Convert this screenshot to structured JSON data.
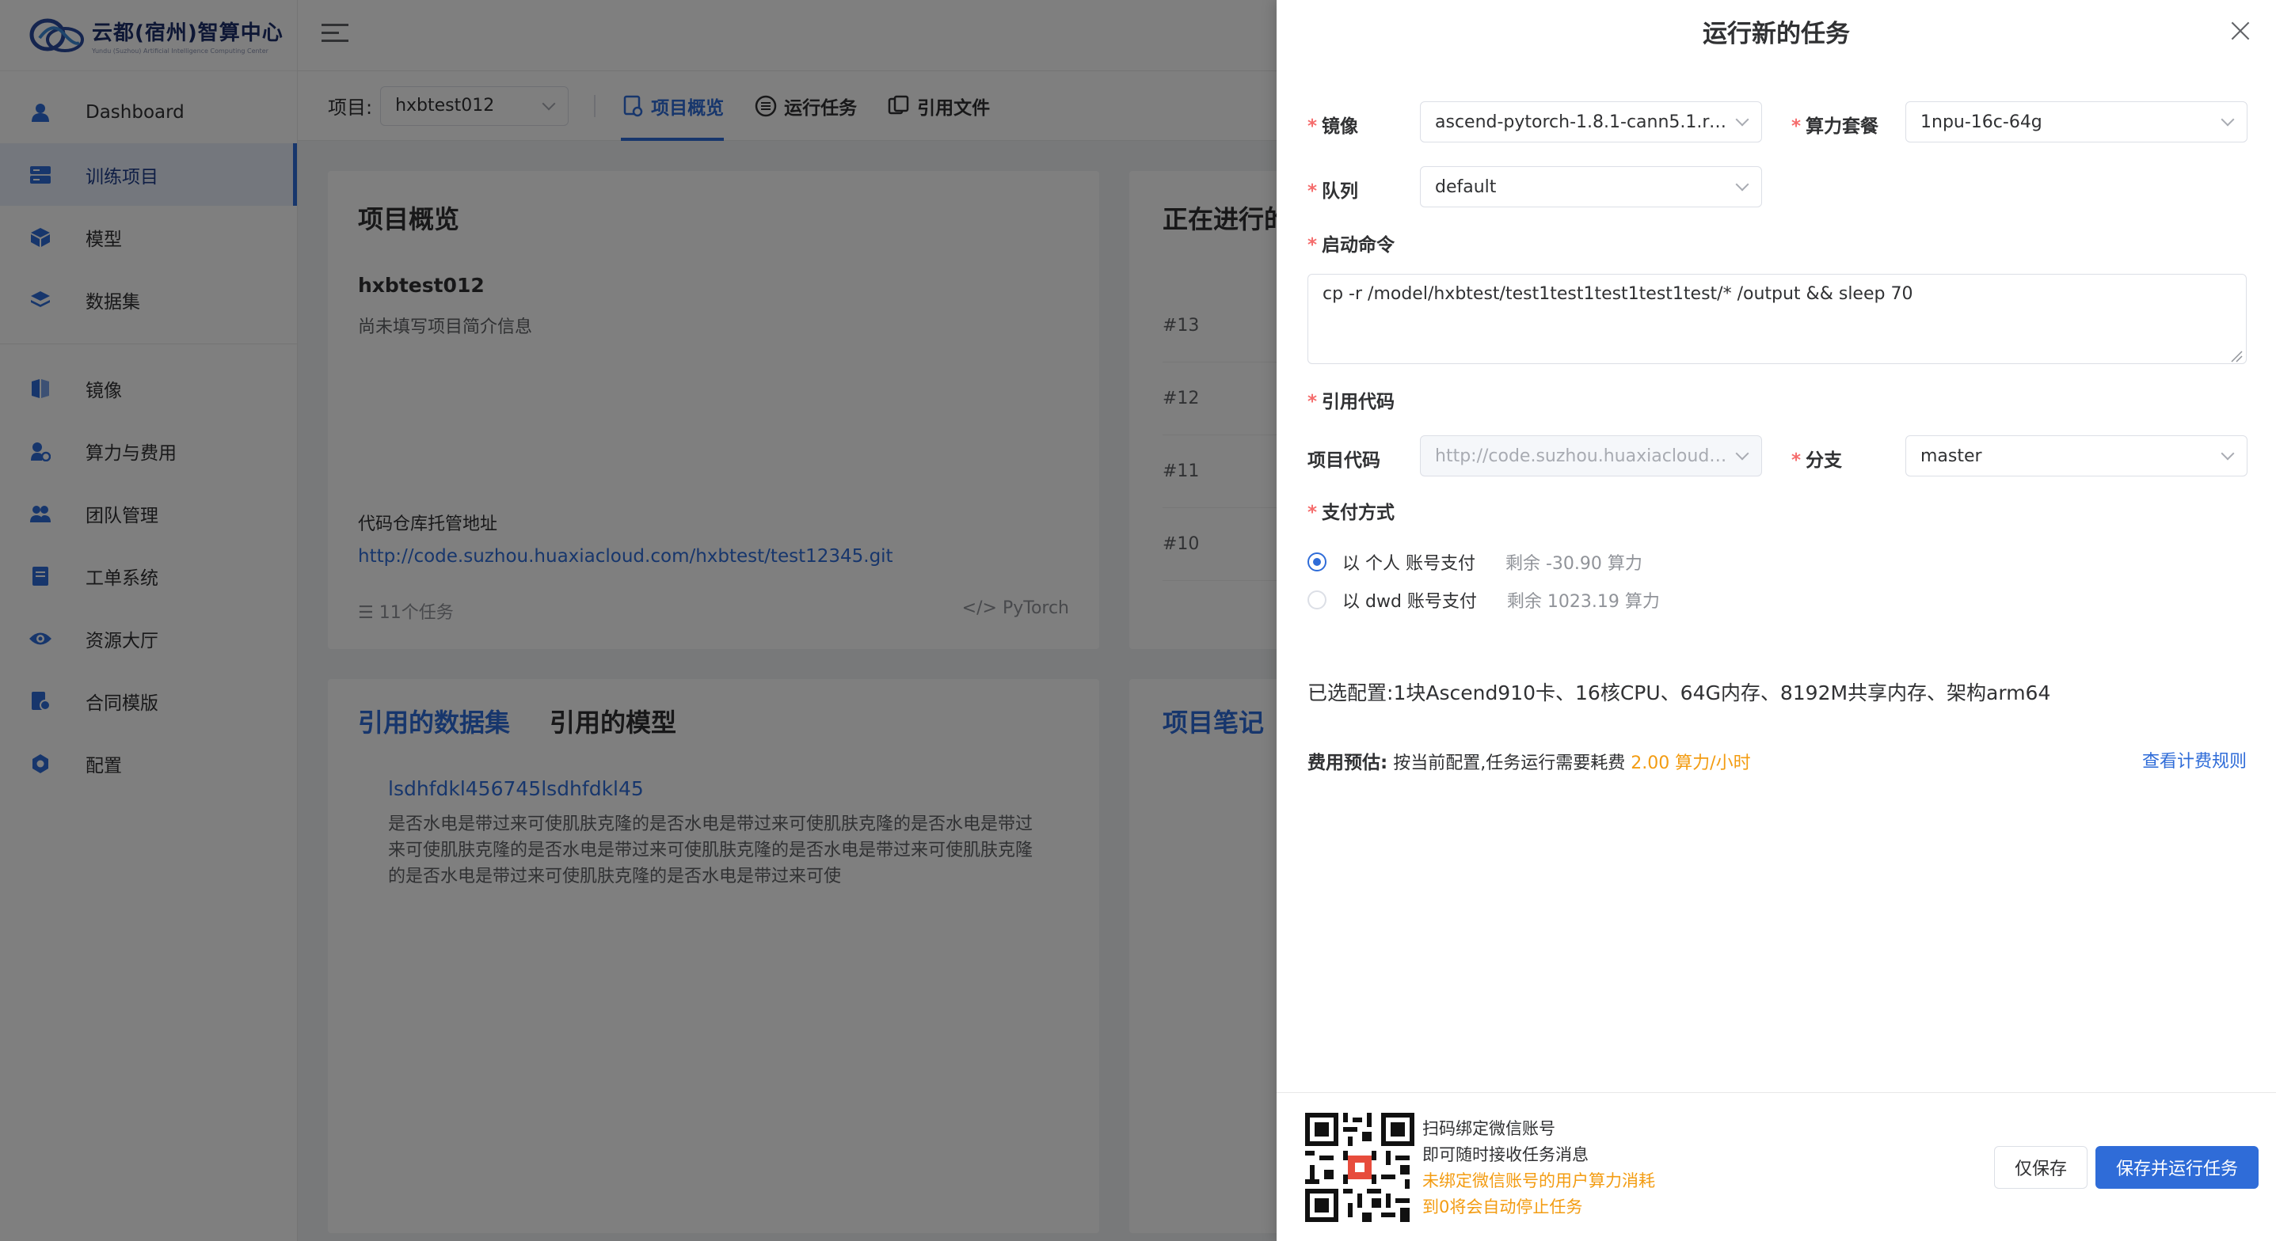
{
  "brand": {
    "title": "云都(宿州)智算中心",
    "subtitle": "Yundu (Suzhou) Artificial Intelligence Computing Center"
  },
  "sidebar": {
    "items": [
      {
        "label": "Dashboard",
        "icon": "user-icon"
      },
      {
        "label": "训练项目",
        "icon": "project-icon",
        "active": true
      },
      {
        "label": "模型",
        "icon": "cube-icon"
      },
      {
        "label": "数据集",
        "icon": "layers-icon"
      },
      {
        "label": "镜像",
        "icon": "image-icon"
      },
      {
        "label": "算力与费用",
        "icon": "compute-icon"
      },
      {
        "label": "团队管理",
        "icon": "team-icon"
      },
      {
        "label": "工单系统",
        "icon": "ticket-icon"
      },
      {
        "label": "资源大厅",
        "icon": "eye-icon"
      },
      {
        "label": "合同模版",
        "icon": "contract-icon"
      },
      {
        "label": "配置",
        "icon": "gear-icon"
      }
    ]
  },
  "subbar": {
    "project_label": "项目:",
    "project_value": "hxbtest012",
    "tabs": [
      {
        "label": "项目概览",
        "active": true
      },
      {
        "label": "运行任务"
      },
      {
        "label": "引用文件"
      }
    ]
  },
  "overview": {
    "title": "项目概览",
    "name": "hxbtest012",
    "description": "尚未填写项目简介信息",
    "repo_label": "代码仓库托管地址",
    "repo_url": "http://code.suzhou.huaxiacloud.com/hxbtest/test12345.git",
    "task_count": "11个任务",
    "framework": "PyTorch"
  },
  "running": {
    "title": "正在进行的任务",
    "rows": [
      "#13",
      "#12",
      "#11",
      "#10"
    ]
  },
  "datasets": {
    "tabs": [
      "引用的数据集",
      "引用的模型"
    ],
    "item_name": "lsdhfdkl456745lsdhfdkl45",
    "item_desc": "是否水电是带过来可使肌肤克隆的是否水电是带过来可使肌肤克隆的是否水电是带过来可使肌肤克隆的是否水电是带过来可使肌肤克隆的是否水电是带过来可使肌肤克隆的是否水电是带过来可使肌肤克隆的是否水电是带过来可使"
  },
  "notes": {
    "title": "项目笔记"
  },
  "drawer": {
    "title": "运行新的任务",
    "image_label": "镜像",
    "image_value": "ascend-pytorch-1.8.1-cann5.1.rc2...",
    "package_label": "算力套餐",
    "package_value": "1npu-16c-64g",
    "queue_label": "队列",
    "queue_value": "default",
    "command_label": "启动命令",
    "command_value": "cp -r /model/hxbtest/test1test1test1test1test/* /output && sleep 70",
    "code_ref_label": "引用代码",
    "project_code_label": "项目代码",
    "project_code_value": "http://code.suzhou.huaxiacloud.c...",
    "branch_label": "分支",
    "branch_value": "master",
    "payment_label": "支付方式",
    "payment_options": [
      {
        "label": "以 个人 账号支付",
        "balance": "剩余 -30.90 算力",
        "checked": true
      },
      {
        "label": "以 dwd 账号支付",
        "balance": "剩余 1023.19 算力",
        "checked": false
      }
    ],
    "config_label": "已选配置:",
    "config_value": "1块Ascend910卡、16核CPU、64G内存、8192M共享内存、架构arm64",
    "cost_label": "费用预估:",
    "cost_prefix": "按当前配置,任务运行需要耗费",
    "cost_amount": "2.00 算力/小时",
    "cost_rule_link": "查看计费规则",
    "qr_line1": "扫码绑定微信账号",
    "qr_line2": "即可随时接收任务消息",
    "qr_warn1": "未绑定微信账号的用户算力消耗",
    "qr_warn2": "到0将会自动停止任务",
    "save_only_label": "仅保存",
    "save_run_label": "保存并运行任务"
  },
  "colors": {
    "primary": "#2f6cd8",
    "required": "#f56c6c",
    "warning": "#f39c12"
  }
}
